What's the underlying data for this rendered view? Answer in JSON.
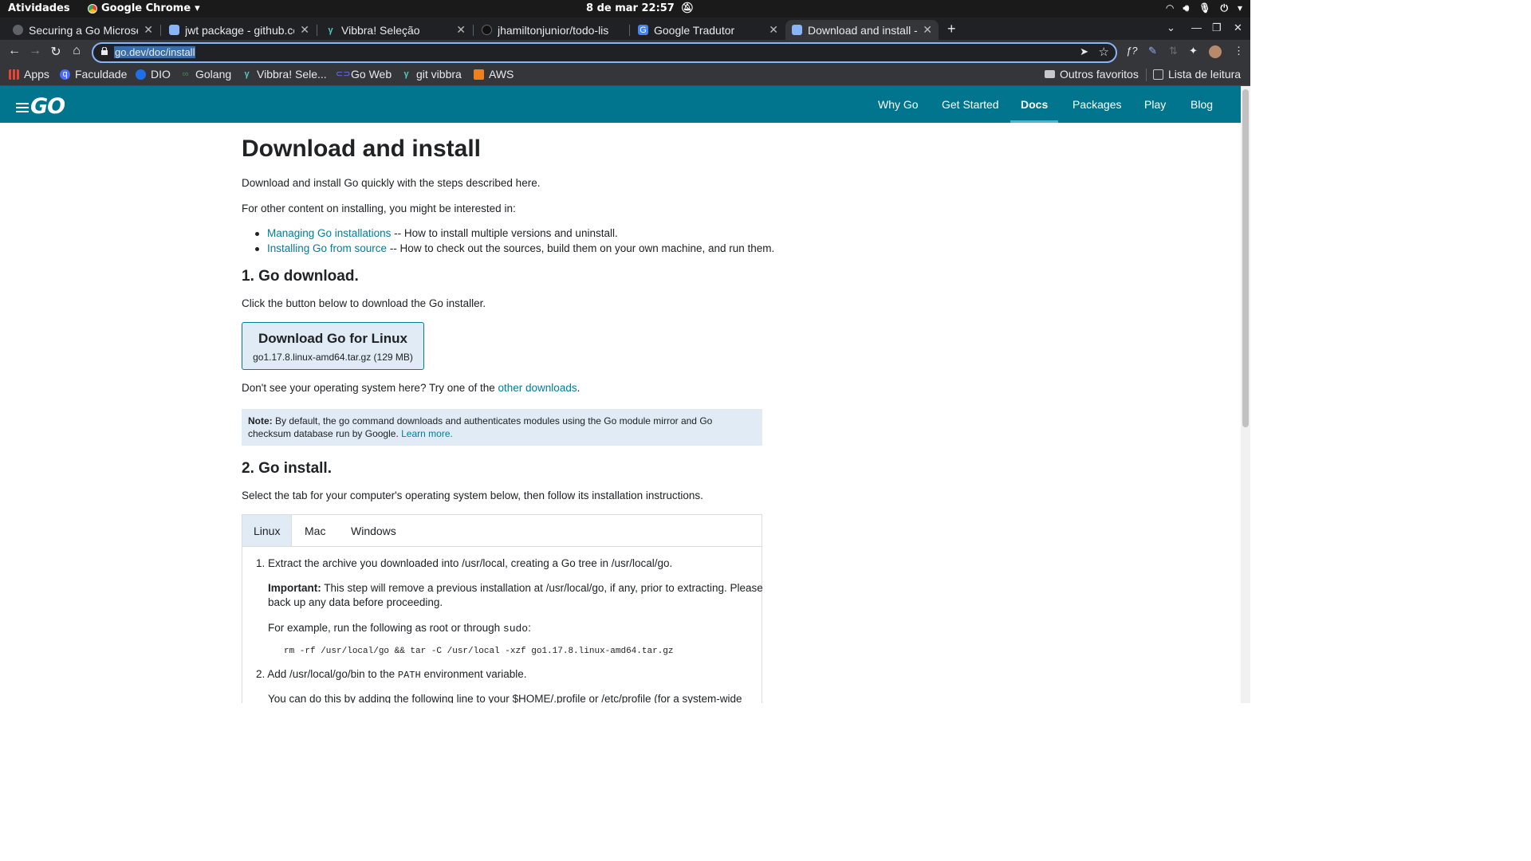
{
  "system_bar": {
    "activities": "Atividades",
    "app_name": "Google Chrome",
    "clock": "8 de mar  22:57"
  },
  "browser": {
    "tabs": [
      {
        "title": "Securing a Go Microse",
        "favicon_color": "#5f6368",
        "active": false
      },
      {
        "title": "jwt package - github.co",
        "favicon_color": "#8ab4f8",
        "active": false
      },
      {
        "title": "Vibbra! Seleção",
        "favicon_color": "#4ecdc4",
        "active": false
      },
      {
        "title": "jhamiltonjunior/todo-lis",
        "favicon_color": "#111111",
        "active": false
      },
      {
        "title": "Google Tradutor",
        "favicon_color": "#4285f4",
        "active": false
      },
      {
        "title": "Download and install -",
        "favicon_color": "#8ab4f8",
        "active": true
      }
    ],
    "url": "go.dev/doc/install",
    "bookmarks": [
      {
        "label": "Apps",
        "icon": "apps-grid-icon",
        "color": "#ea4335"
      },
      {
        "label": "Faculdade",
        "icon": "q-icon",
        "color": "#4a6cf7"
      },
      {
        "label": "DIO",
        "icon": "dio-icon",
        "color": "#1f6feb"
      },
      {
        "label": "Golang",
        "icon": "golang-icon",
        "color": "#3a8a5a"
      },
      {
        "label": "Vibbra! Sele...",
        "icon": "vibbra-icon",
        "color": "#4ecdc4"
      },
      {
        "label": "Go Web",
        "icon": "link-icon",
        "color": "#6a7cff"
      },
      {
        "label": "git vibbra",
        "icon": "vibbra-icon",
        "color": "#4ecdc4"
      },
      {
        "label": "AWS",
        "icon": "aws-icon",
        "color": "#f0811a"
      }
    ],
    "other_bookmarks": "Outros favoritos",
    "reading_list": "Lista de leitura"
  },
  "page": {
    "header": {
      "logo": "GO",
      "nav": [
        "Why Go",
        "Get Started",
        "Docs",
        "Packages",
        "Play",
        "Blog"
      ],
      "active_nav": "Docs"
    },
    "title": "Download and install",
    "intro": "Download and install Go quickly with the steps described here.",
    "other_content": "For other content on installing, you might be interested in:",
    "links": [
      {
        "link": "Managing Go installations",
        "desc": " -- How to install multiple versions and uninstall."
      },
      {
        "link": "Installing Go from source",
        "desc": " -- How to check out the sources, build them on your own machine, and run them."
      }
    ],
    "section1": {
      "heading": "1. Go download.",
      "text": "Click the button below to download the Go installer.",
      "button_title": "Download Go for Linux",
      "button_file": "go1.17.8.linux-amd64.tar.gz (129 MB)",
      "other_prefix": "Don't see your operating system here? Try one of the ",
      "other_link": "other downloads",
      "other_suffix": ".",
      "note_label": "Note:",
      "note_text": " By default, the go command downloads and authenticates modules using the Go module mirror and Go checksum database run by Google. ",
      "note_link": "Learn more."
    },
    "section2": {
      "heading": "2. Go install.",
      "text": "Select the tab for your computer's operating system below, then follow its installation instructions.",
      "os_tabs": [
        "Linux",
        "Mac",
        "Windows"
      ],
      "active_tab": "Linux",
      "step1": "1. Extract the archive you downloaded into /usr/local, creating a Go tree in /usr/local/go.",
      "important_label": "Important:",
      "important_text_1": " This step will remove a previous installation at /usr/local/go, if any, prior to extracting. Please",
      "important_text_2": "back up any data before proceeding.",
      "example_prefix": "For example, run the following as root or through ",
      "example_code": "sudo",
      "example_suffix": ":",
      "command": "rm -rf /usr/local/go && tar -C /usr/local -xzf go1.17.8.linux-amd64.tar.gz",
      "step2_prefix": "2. Add /usr/local/go/bin to the ",
      "step2_code": "PATH",
      "step2_suffix": " environment variable.",
      "step2_more": "You can do this by adding the following line to your $HOME/.profile or /etc/profile (for a system-wide"
    }
  }
}
